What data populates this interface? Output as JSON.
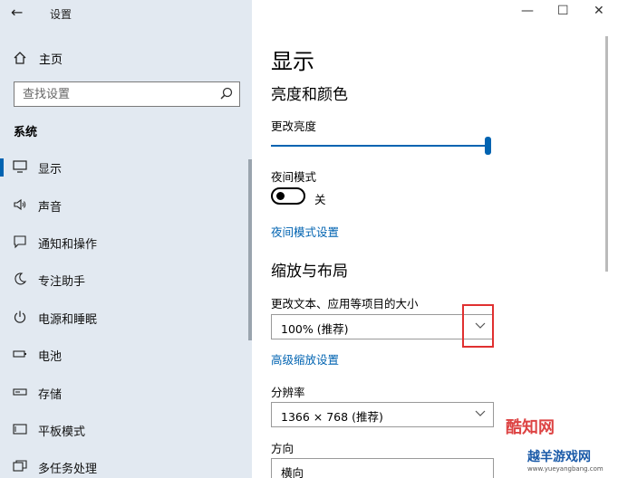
{
  "window": {
    "title": "设置",
    "controls": {
      "minimize": "—",
      "maximize": "☐",
      "close": "✕"
    }
  },
  "sidebar": {
    "home_label": "主页",
    "search_placeholder": "查找设置",
    "section_label": "系统",
    "items": [
      {
        "label": "显示",
        "icon": "monitor-icon",
        "active": true
      },
      {
        "label": "声音",
        "icon": "speaker-icon"
      },
      {
        "label": "通知和操作",
        "icon": "notification-icon"
      },
      {
        "label": "专注助手",
        "icon": "moon-icon"
      },
      {
        "label": "电源和睡眠",
        "icon": "power-icon"
      },
      {
        "label": "电池",
        "icon": "battery-icon"
      },
      {
        "label": "存储",
        "icon": "storage-icon"
      },
      {
        "label": "平板模式",
        "icon": "tablet-icon"
      },
      {
        "label": "多任务处理",
        "icon": "multitask-icon"
      }
    ]
  },
  "main": {
    "title": "显示",
    "brightness_section": "亮度和颜色",
    "brightness_label": "更改亮度",
    "brightness_level": 1.0,
    "night_mode_label": "夜间模式",
    "night_mode_state": "关",
    "night_mode_link": "夜间模式设置",
    "scale_section": "缩放与布局",
    "scale_label": "更改文本、应用等项目的大小",
    "scale_value": "100% (推荐)",
    "advanced_scale_link": "高级缩放设置",
    "resolution_label": "分辨率",
    "resolution_value": "1366 × 768 (推荐)",
    "orientation_label": "方向",
    "orientation_value": "横向"
  },
  "watermark": {
    "text1": "酷知网",
    "text2": "越羊游戏网",
    "url": "www.yueyangbang.com"
  },
  "colors": {
    "accent": "#0063b1",
    "sidebar_bg": "#e2e9f1",
    "highlight": "#e03030"
  }
}
